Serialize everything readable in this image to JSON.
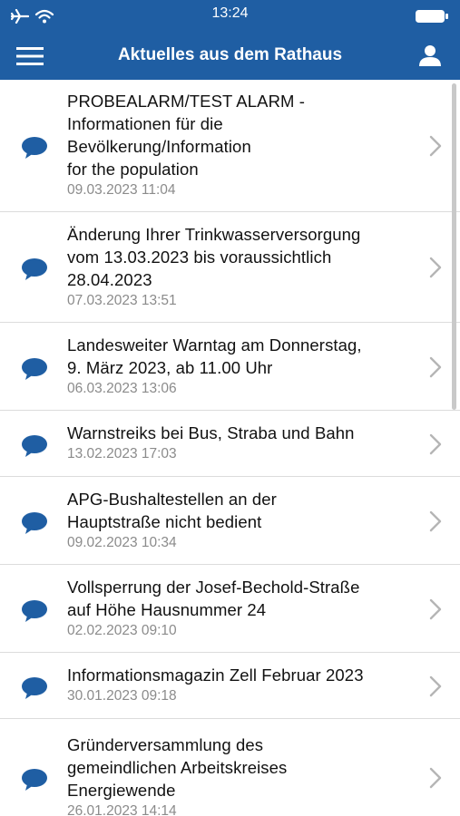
{
  "status_bar": {
    "time": "13:24"
  },
  "header": {
    "title": "Aktuelles aus dem Rathaus"
  },
  "colors": {
    "primary": "#1f5ea3"
  },
  "icons": {
    "menu": "hamburger-menu-icon",
    "profile": "user-profile-icon",
    "item": "speech-bubble-icon",
    "chevron": "chevron-right-icon"
  },
  "news": [
    {
      "title": "PROBEALARM/TEST ALARM -\nInformationen für die\nBevölkerung/Information\nfor the population",
      "date": "09.03.2023 11:04"
    },
    {
      "title": "Änderung Ihrer Trinkwasserversorgung\nvom 13.03.2023 bis voraussichtlich\n28.04.2023",
      "date": "07.03.2023 13:51"
    },
    {
      "title": "Landesweiter Warntag am Donnerstag,\n9. März 2023, ab 11.00 Uhr",
      "date": "06.03.2023 13:06"
    },
    {
      "title": "Warnstreiks bei Bus, Straba und Bahn",
      "date": "13.02.2023 17:03"
    },
    {
      "title": "APG-Bushaltestellen an der\nHauptstraße nicht bedient",
      "date": "09.02.2023 10:34"
    },
    {
      "title": "Vollsperrung der Josef-Bechold-Straße\nauf Höhe Hausnummer 24",
      "date": "02.02.2023 09:10"
    },
    {
      "title": "Informationsmagazin Zell Februar 2023",
      "date": "30.01.2023 09:18"
    },
    {
      "title": "Gründerversammlung des\ngemeindlichen Arbeitskreises\nEnergiewende",
      "date": "26.01.2023 14:14"
    }
  ]
}
